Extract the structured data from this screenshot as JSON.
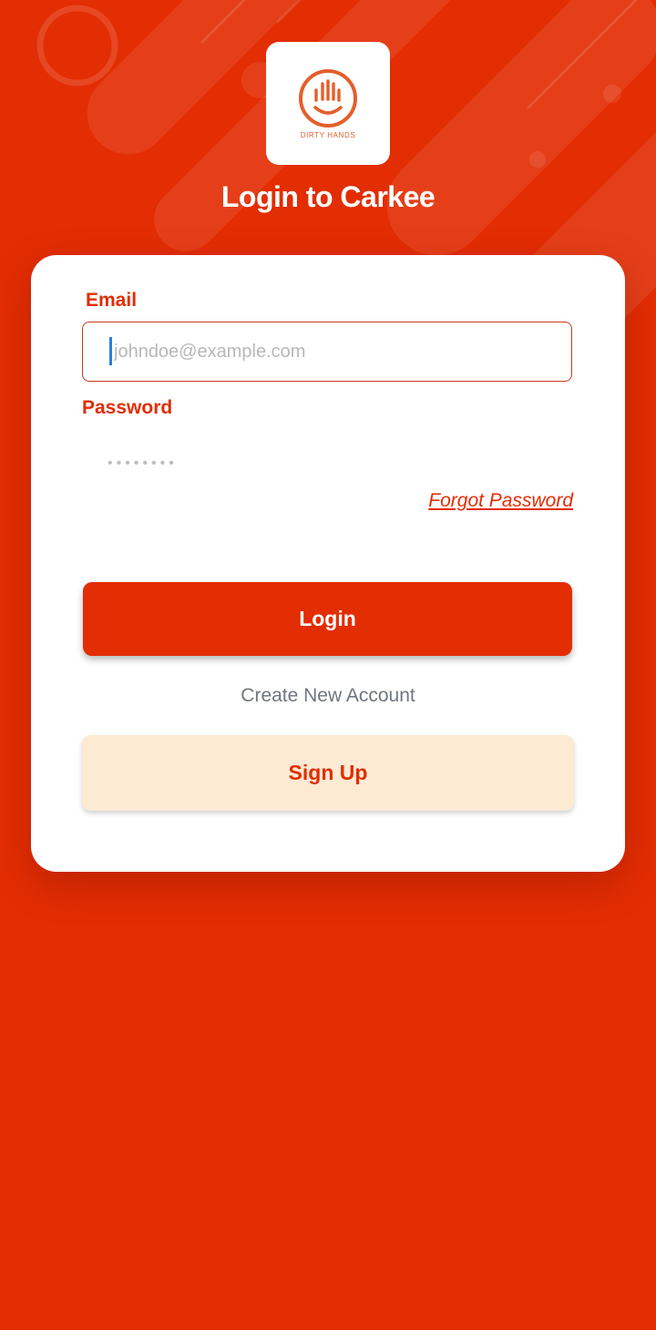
{
  "brand": {
    "logo_text": "DIRTY HANDS",
    "accent_color": "#e32d03",
    "logo_color": "#e45f2a"
  },
  "header": {
    "title": "Login to Carkee"
  },
  "form": {
    "email_label": "Email",
    "email_placeholder": "johndoe@example.com",
    "password_label": "Password",
    "password_placeholder": "••••••••",
    "forgot_password": "Forgot Password",
    "login_label": "Login",
    "create_account_text": "Create New Account",
    "signup_label": "Sign Up"
  }
}
